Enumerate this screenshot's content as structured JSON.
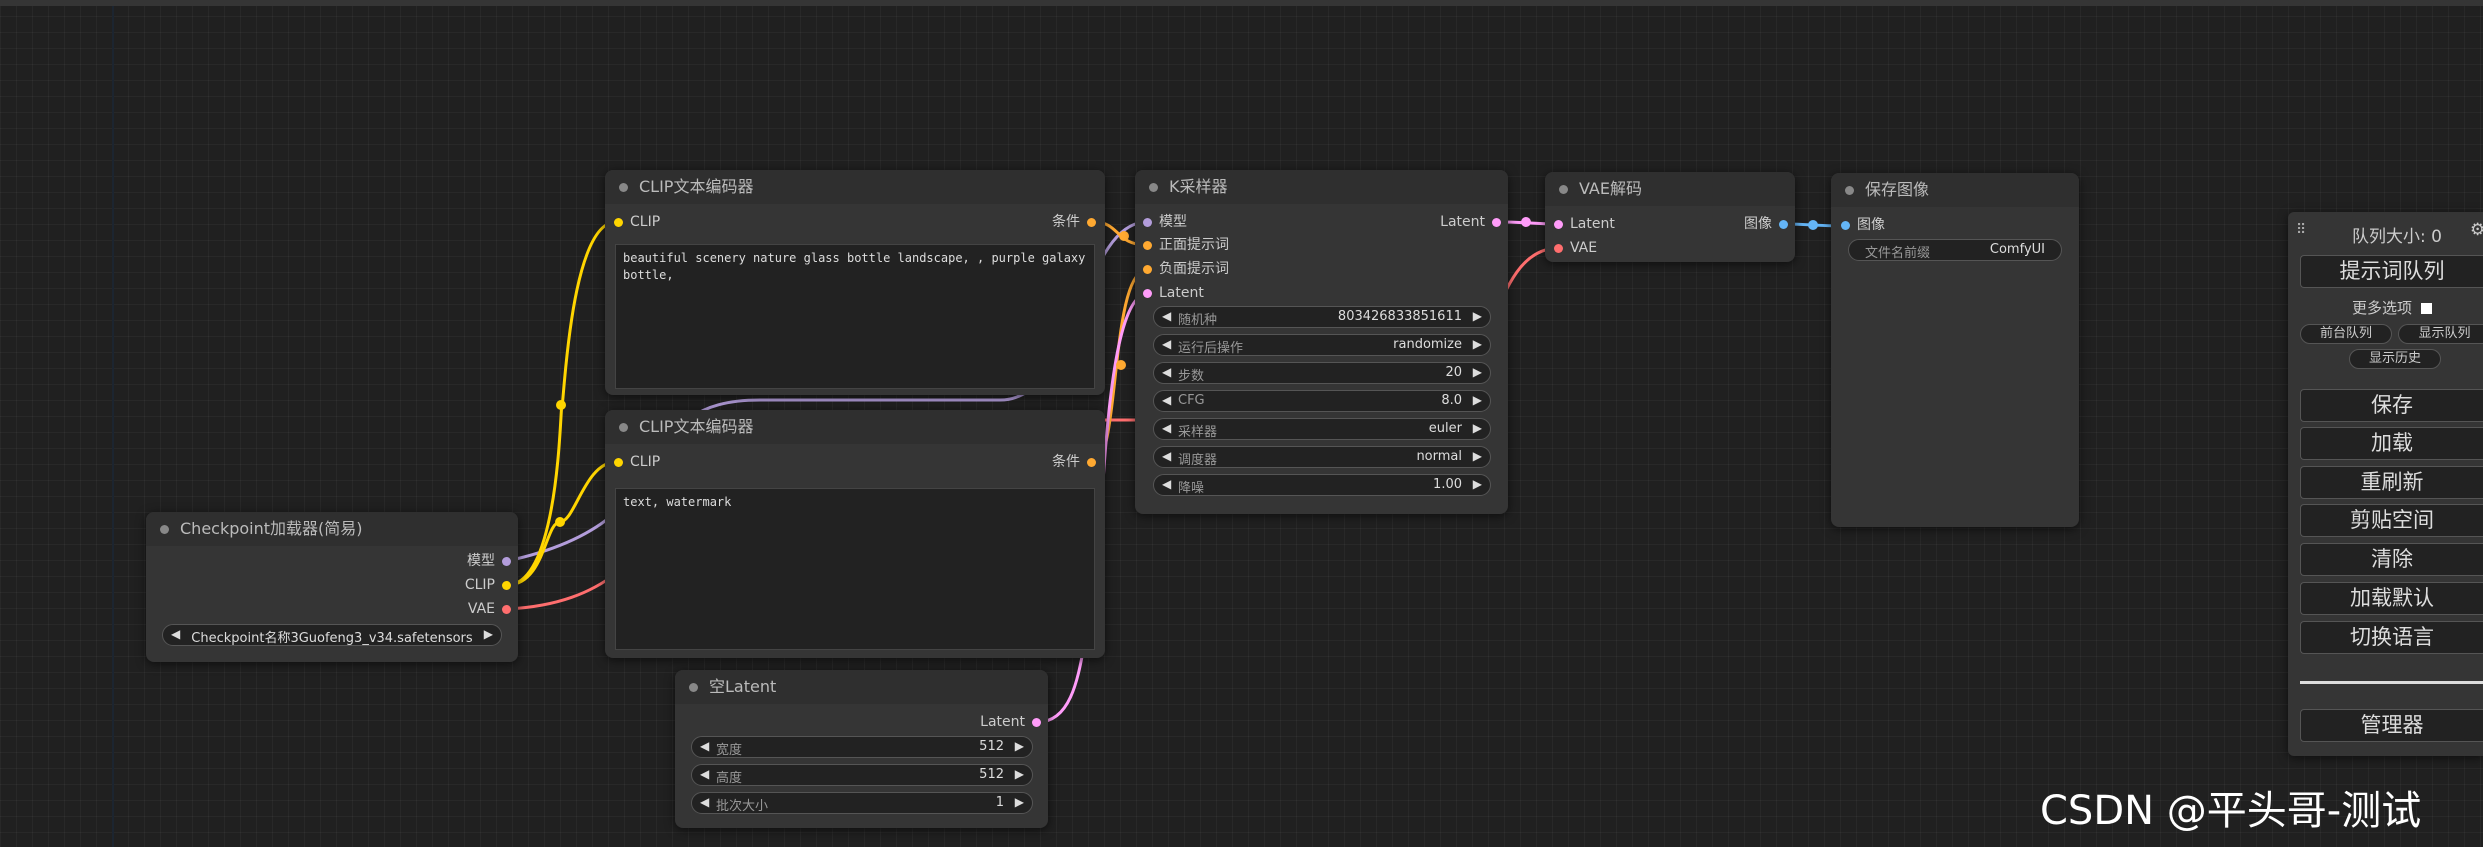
{
  "nodes": {
    "checkpoint": {
      "title": "Checkpoint加载器(简易)",
      "outputs": {
        "model": "模型",
        "clip": "CLIP",
        "vae": "VAE"
      },
      "ckpt_widget": "Checkpoint名称3Guofeng3_v34.safetensors"
    },
    "clip_pos": {
      "title": "CLIP文本编码器",
      "input_clip": "CLIP",
      "output_cond": "条件",
      "text": "beautiful scenery nature glass bottle landscape, , purple galaxy bottle,"
    },
    "clip_neg": {
      "title": "CLIP文本编码器",
      "input_clip": "CLIP",
      "output_cond": "条件",
      "text": "text, watermark"
    },
    "empty_latent": {
      "title": "空Latent",
      "output_latent": "Latent",
      "widgets": [
        {
          "label": "宽度",
          "value": "512"
        },
        {
          "label": "高度",
          "value": "512"
        },
        {
          "label": "批次大小",
          "value": "1"
        }
      ]
    },
    "ksampler": {
      "title": "K采样器",
      "inputs": {
        "model": "模型",
        "positive": "正面提示词",
        "negative": "负面提示词",
        "latent": "Latent"
      },
      "output_latent": "Latent",
      "widgets": [
        {
          "label": "随机种",
          "value": "803426833851611"
        },
        {
          "label": "运行后操作",
          "value": "randomize"
        },
        {
          "label": "步数",
          "value": "20"
        },
        {
          "label": "CFG",
          "value": "8.0"
        },
        {
          "label": "采样器",
          "value": "euler"
        },
        {
          "label": "调度器",
          "value": "normal"
        },
        {
          "label": "降噪",
          "value": "1.00"
        }
      ]
    },
    "vae_decode": {
      "title": "VAE解码",
      "inputs": {
        "latent": "Latent",
        "vae": "VAE"
      },
      "output_image": "图像"
    },
    "save_image": {
      "title": "保存图像",
      "input_image": "图像",
      "widget": {
        "label": "文件名前缀",
        "value": "ComfyUI"
      }
    }
  },
  "panel": {
    "queue_size": "队列大小: 0",
    "queue_prompt": "提示词队列",
    "extra_options": "更多选项",
    "view_queue": "前台队列",
    "view_queue2": "显示队列",
    "view_history": "显示历史",
    "buttons": [
      "保存",
      "加载",
      "重刷新",
      "剪贴空间",
      "清除",
      "加载默认",
      "切换语言"
    ],
    "manager": "管理器"
  },
  "watermark": "CSDN @平头哥-测试",
  "colors": {
    "model": "#b39ddb",
    "clip": "#ffd500",
    "vae": "#ff6e6e",
    "conditioning": "#ffa931",
    "latent": "#ff9cf9",
    "image": "#64b5f6",
    "background": "#202020",
    "node": "#353535"
  }
}
